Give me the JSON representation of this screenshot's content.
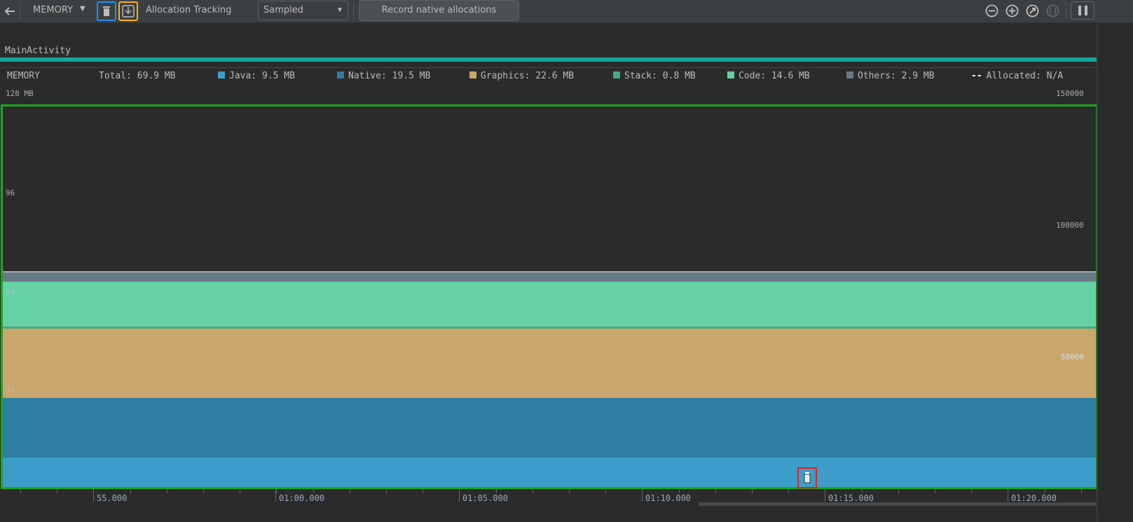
{
  "toolbar": {
    "back_icon": "arrow-left-icon",
    "profiler_select": "MEMORY",
    "gc_icon": "trash-icon",
    "dump_icon": "heap-dump-icon",
    "allocation_tracking_label": "Allocation Tracking",
    "allocation_tracking_value": "Sampled",
    "record_button": "Record native allocations",
    "zoom_out_icon": "zoom-out-icon",
    "zoom_in_icon": "zoom-in-icon",
    "reset_zoom_icon": "reset-zoom-icon",
    "zoom_to_selection_icon": "zoom-to-selection-icon",
    "pause_icon": "pause-icon"
  },
  "activity": {
    "label": "MainActivity",
    "color": "#13a89a"
  },
  "legend": {
    "title": "MEMORY",
    "total": "Total: 69.9 MB",
    "items": [
      {
        "label": "Java: 9.5 MB",
        "color": "#3c9dca"
      },
      {
        "label": "Native: 19.5 MB",
        "color": "#2e7ea3"
      },
      {
        "label": "Graphics: 22.6 MB",
        "color": "#c9a66b"
      },
      {
        "label": "Stack: 0.8 MB",
        "color": "#48a884"
      },
      {
        "label": "Code: 14.6 MB",
        "color": "#66d1a5"
      },
      {
        "label": "Others: 2.9 MB",
        "color": "#677b87"
      }
    ],
    "allocated": "Allocated: N/A"
  },
  "chart_data": {
    "type": "area",
    "stacked": true,
    "y_left_ticks": [
      "128 MB",
      "96",
      "64",
      "32"
    ],
    "y_left_range_mb": [
      0,
      128
    ],
    "y_right_ticks": [
      "150000",
      "100000",
      "50000"
    ],
    "x_ticks": [
      "55.000",
      "01:00.000",
      "01:05.000",
      "01:10.000",
      "01:15.000",
      "01:20.000"
    ],
    "series": [
      {
        "name": "Java",
        "value_mb": 9.5,
        "color": "#3c9dca"
      },
      {
        "name": "Native",
        "value_mb": 19.5,
        "color": "#2e7ea3"
      },
      {
        "name": "Graphics",
        "value_mb": 22.6,
        "color": "#c9a66b"
      },
      {
        "name": "Stack",
        "value_mb": 0.8,
        "color": "#48a884"
      },
      {
        "name": "Code",
        "value_mb": 14.6,
        "color": "#66d1a5"
      },
      {
        "name": "Others",
        "value_mb": 2.9,
        "color": "#677b87"
      }
    ],
    "total_mb": 69.9,
    "gc_event": {
      "time": "01:13.9",
      "icon": "trash-icon"
    }
  }
}
